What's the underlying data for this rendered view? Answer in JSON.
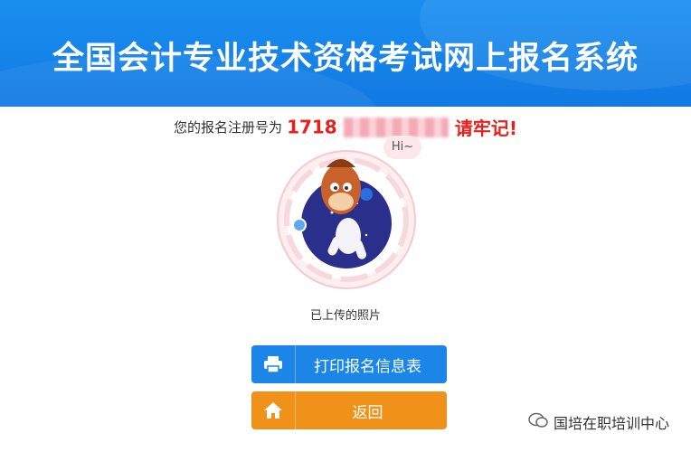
{
  "header": {
    "title": "全国会计专业技术资格考试网上报名系统"
  },
  "registration": {
    "prefix": "您的报名注册号为",
    "number_visible": "1718",
    "suffix": "请牢记!"
  },
  "mascot": {
    "greeting": "Hi~"
  },
  "photo": {
    "label": "已上传的照片"
  },
  "buttons": {
    "print_label": "打印报名信息表",
    "back_label": "返回",
    "print_icon": "printer-icon",
    "back_icon": "home-icon"
  },
  "watermark": {
    "text": "国培在职培训中心",
    "icon": "wechat-icon"
  },
  "colors": {
    "header": "#1a8ff0",
    "accent_red": "#e8201c",
    "print_btn": "#1b86e8",
    "back_btn": "#f0921a"
  }
}
